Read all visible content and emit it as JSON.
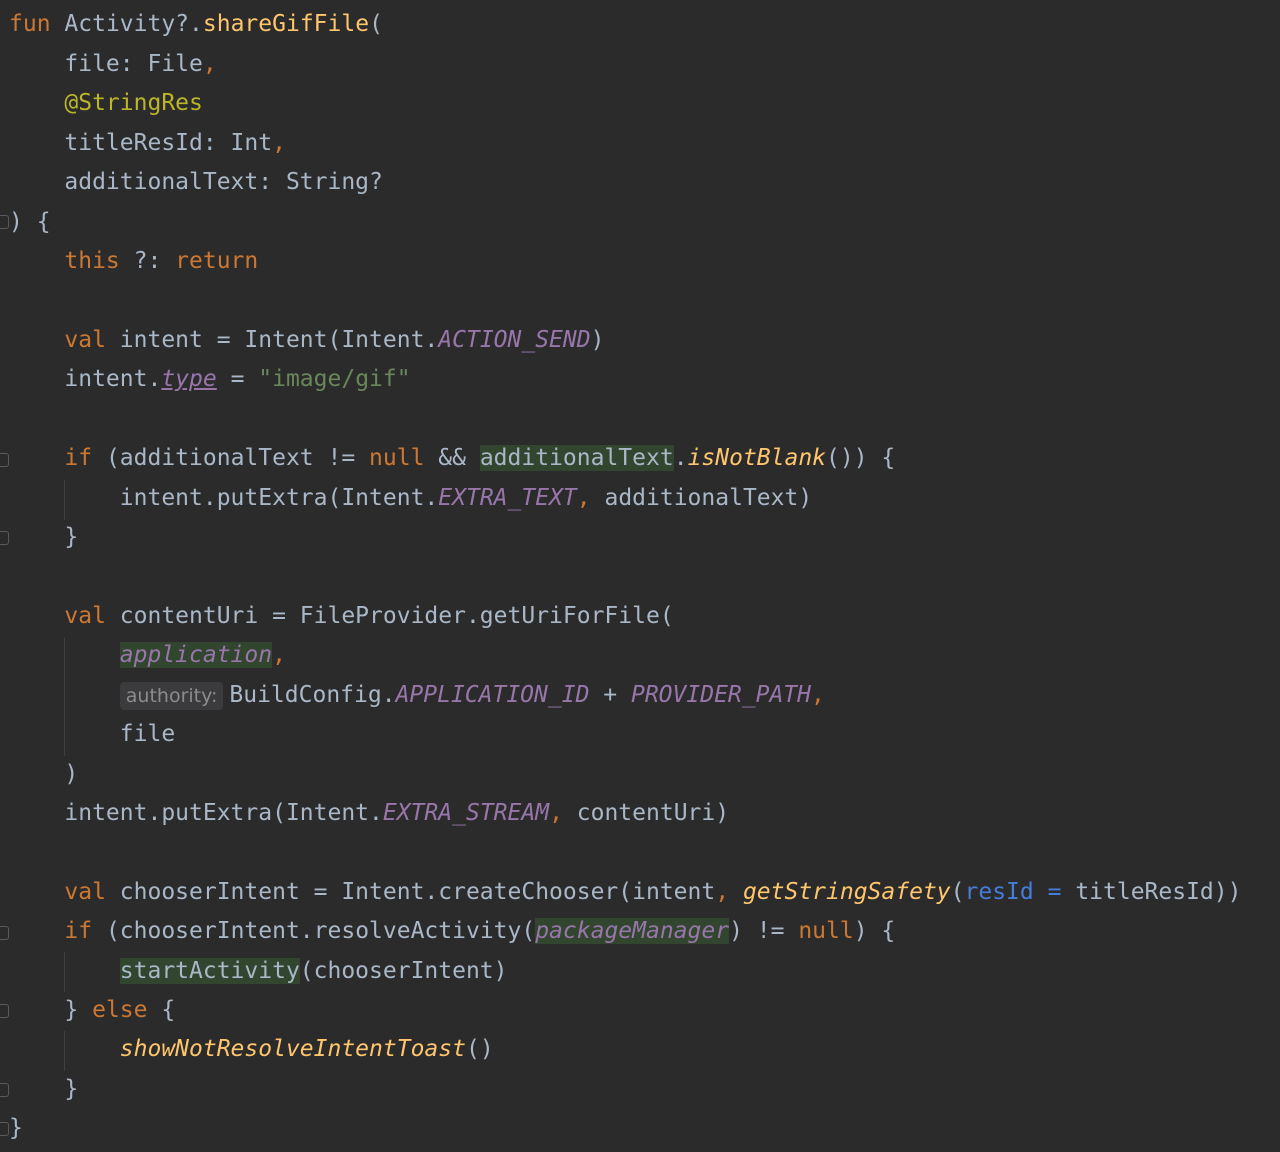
{
  "editor": {
    "language": "Kotlin",
    "theme": {
      "background": "#2b2b2c",
      "text": "#a9b7c6",
      "keyword": "#cc7832",
      "function": "#ffc66d",
      "annotation": "#bbb529",
      "string": "#6a8759",
      "constant": "#9876aa",
      "named_arg": "#467cda",
      "highlight": "#32452f"
    },
    "tokens": {
      "kw_fun": "fun",
      "receiver": "Activity?.",
      "fn_name": "shareGifFile",
      "open_paren": "(",
      "p1_name": "file: File",
      "p2_ann": "@StringRes",
      "p3_name": "titleResId: Int",
      "p4_name": "additionalText: String?",
      "close_sig": ") {",
      "kw_this": "this",
      "elvis": " ?: ",
      "kw_return": "return",
      "kw_val": "val",
      "v_intent": " intent = Intent(Intent.",
      "c_action_send": "ACTION_SEND",
      "intent_dot": "intent.",
      "p_type": "type",
      "assign": " = ",
      "s_gif": "\"image/gif\"",
      "kw_if": "if",
      "cond_a": " (additionalText != ",
      "kw_null": "null",
      "cond_and": " && ",
      "additional_text": "additionalText",
      "dot": ".",
      "fn_not_blank": "isNotBlank",
      "cond_end": "()) {",
      "put_extra_a": "intent.putExtra(Intent.",
      "c_extra_text": "EXTRA_TEXT",
      "comma": ",",
      "arg_additional": " additionalText)",
      "close_brace": "}",
      "v_content_uri": " contentUri = FileProvider.getUriForFile(",
      "p_application": "application",
      "hint_authority": "authority:",
      "build_config": "BuildConfig.",
      "c_app_id": "APPLICATION_ID",
      "plus": " + ",
      "c_provider_path": "PROVIDER_PATH",
      "arg_file": "file",
      "close_paren": ")",
      "put_extra_b": "intent.putExtra(Intent.",
      "c_extra_stream": "EXTRA_STREAM",
      "arg_content_uri": " contentUri)",
      "v_chooser": " chooserIntent = Intent.createChooser(intent",
      "fn_get_string": "getStringSafety",
      "named_res_id": "resId",
      "named_eq": " = ",
      "arg_title": "titleResId))",
      "cond2_a": " (chooserIntent.resolveActivity(",
      "p_package_manager": "packageManager",
      "cond2_b": ") != ",
      "cond2_end": ") {",
      "start_activity": "startActivity",
      "start_args": "(chooserIntent)",
      "else_open": "} ",
      "kw_else": "else",
      "else_brace": " {",
      "fn_show_toast": "showNotResolveIntentToast",
      "empty_call": "()"
    }
  }
}
